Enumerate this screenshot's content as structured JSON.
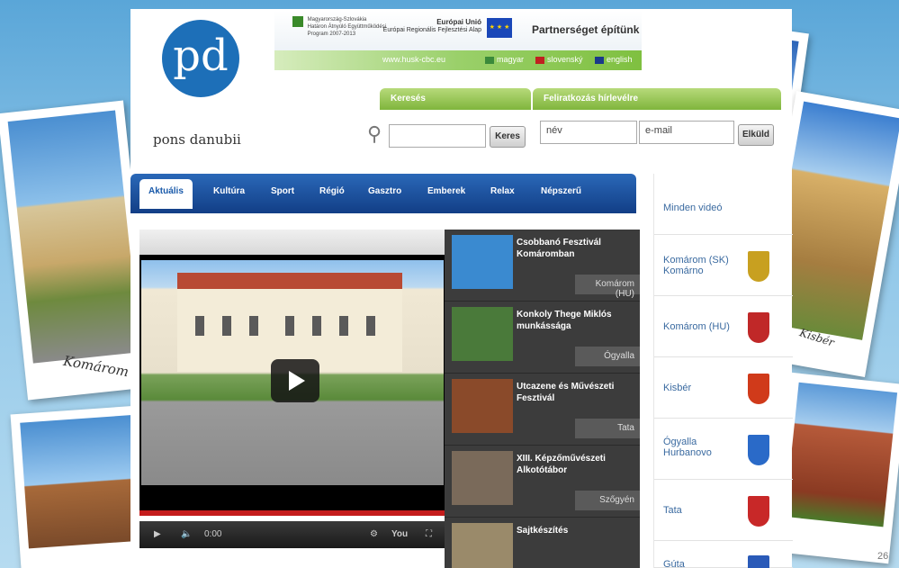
{
  "eu_logos": {
    "program_text": [
      "Magyarország-Szlovákia",
      "Határon Átnyúló Együttműködési",
      "Program 2007-2013"
    ],
    "eu_text": [
      "Európai Unió",
      "Európai Regionális Fejlesztési Alap"
    ],
    "partner_text": "Partnerséget építünk",
    "url": "www.husk-cbc.eu"
  },
  "languages": [
    {
      "label": "magyar",
      "color": "#3a8a3a"
    },
    {
      "label": "slovenský",
      "color": "#c02020"
    },
    {
      "label": "english",
      "color": "#1a3a8a"
    }
  ],
  "logo": {
    "mark": "pd",
    "name": "pons danubii"
  },
  "search": {
    "tab_label": "Keresés",
    "button_label": "Keres",
    "value": ""
  },
  "subscribe": {
    "tab_label": "Feliratkozás hírlevélre",
    "name_value": "név",
    "email_value": "e-mail",
    "button_label": "Elküld"
  },
  "nav": [
    "Aktuális",
    "Kultúra",
    "Sport",
    "Régió",
    "Gasztro",
    "Emberek",
    "Relax",
    "Népszerű"
  ],
  "player": {
    "time": "0:00"
  },
  "videos": [
    {
      "title": "Csobbanó Fesztivál Komáromban",
      "location": "Komárom (HU)",
      "thumb": "#3a8ad0"
    },
    {
      "title": "Konkoly Thege Miklós munkássága",
      "location": "Ógyalla",
      "thumb": "#4a7a3a"
    },
    {
      "title": "Utcazene és Művészeti Fesztivál",
      "location": "Tata",
      "thumb": "#8a4a2a"
    },
    {
      "title": "XIII. Képzőművészeti Alkotótábor",
      "location": "Szőgyén",
      "thumb": "#7a6a5a"
    },
    {
      "title": "Sajtkészítés",
      "location": "",
      "thumb": "#9a8a6a"
    }
  ],
  "sidebar": [
    {
      "label": "Minden videó",
      "label2": "",
      "crest": ""
    },
    {
      "label": "Komárom (SK)",
      "label2": "Komárno",
      "crest": "#c8a020"
    },
    {
      "label": "Komárom (HU)",
      "label2": "",
      "crest": "#c02828"
    },
    {
      "label": "Kisbér",
      "label2": "",
      "crest": "#d03a1a"
    },
    {
      "label": "Ógyalla",
      "label2": "Hurbanovo",
      "crest": "#2a6ac8"
    },
    {
      "label": "Tata",
      "label2": "",
      "crest": "#c82828"
    },
    {
      "label": "Gúta",
      "label2": "",
      "crest": "#2a5ab8"
    }
  ],
  "photos": {
    "left_caption": "Komárom",
    "right_caption": "Kisbér"
  },
  "page_number": "26"
}
